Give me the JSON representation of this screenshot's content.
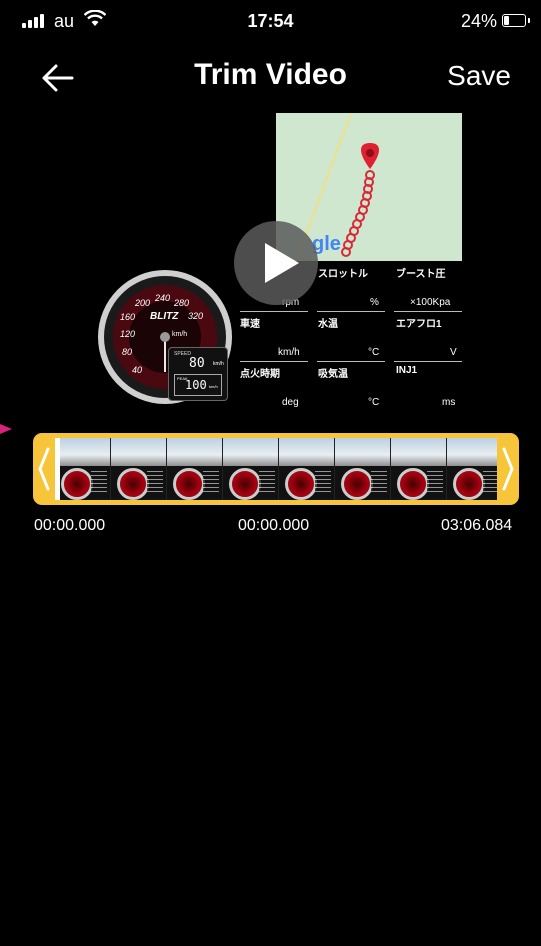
{
  "status_bar": {
    "carrier": "au",
    "time": "17:54",
    "battery": "24%"
  },
  "nav": {
    "title": "Trim Video",
    "save_label": "Save"
  },
  "video": {
    "gauge": {
      "brand": "BLITZ",
      "unit": "km/h",
      "ticks": [
        "40",
        "80",
        "120",
        "160",
        "200",
        "240",
        "280",
        "320"
      ],
      "digital_label": "SPEED",
      "digital_value": "80",
      "digital_unit": "km/h",
      "peak_label": "PEAK",
      "peak_value": "100",
      "peak_unit": "km/h"
    },
    "map_logo": "gle",
    "labels": [
      "スロットル",
      "ブースト圧",
      "rpm",
      "%",
      "×100Kpa",
      "車速",
      "水温",
      "エアフロ1",
      "km/h",
      "°C",
      "V",
      "点火時期",
      "吸気温",
      "INJ1",
      "deg",
      "°C",
      "ms"
    ]
  },
  "timeline": {
    "start_time": "00:00.000",
    "current_time": "00:00.000",
    "end_time": "03:06.084",
    "frame_count": 8
  }
}
